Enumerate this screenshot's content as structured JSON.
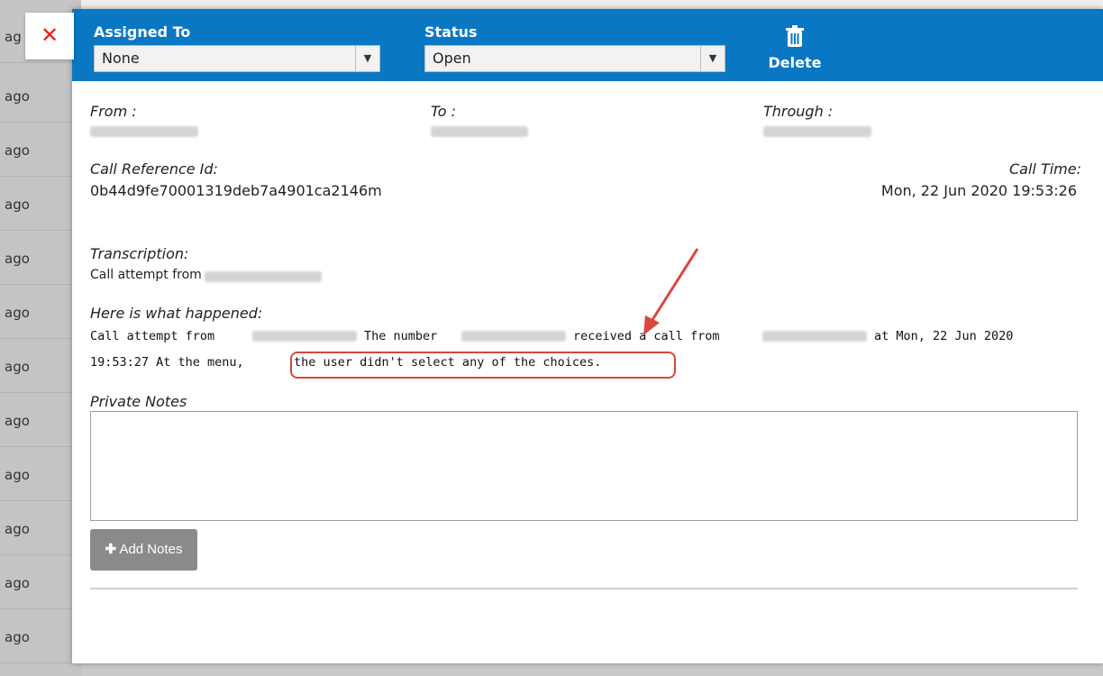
{
  "background_list": {
    "first_label": "ag",
    "row_label": "ago"
  },
  "header": {
    "close_label": "✕",
    "assigned_to": {
      "label": "Assigned To",
      "value": "None"
    },
    "status": {
      "label": "Status",
      "value": "Open"
    },
    "delete_label": "Delete"
  },
  "details": {
    "from_label": "From :",
    "to_label": "To :",
    "through_label": "Through :",
    "call_ref_label": "Call Reference Id:",
    "call_ref_value": "0b44d9fe70001319deb7a4901ca2146m",
    "call_time_label": "Call Time:",
    "call_time_value": "Mon, 22 Jun 2020 19:53:26",
    "transcription_label": "Transcription:",
    "transcription_text": "Call attempt from",
    "happened_label": "Here is what happened:",
    "happened": {
      "part1": "Call attempt from",
      "part2": "The number",
      "part3": "received a call from",
      "part4": "at Mon, 22 Jun 2020",
      "line2_part1": "19:53:27 At the menu,",
      "line2_highlight": "the user didn't select any of the choices."
    },
    "private_notes_label": "Private Notes",
    "add_notes_label": "Add Notes"
  },
  "colors": {
    "header_bg": "#0a77c2",
    "close_icon": "#e2231a",
    "annotation": "#d9463d"
  }
}
